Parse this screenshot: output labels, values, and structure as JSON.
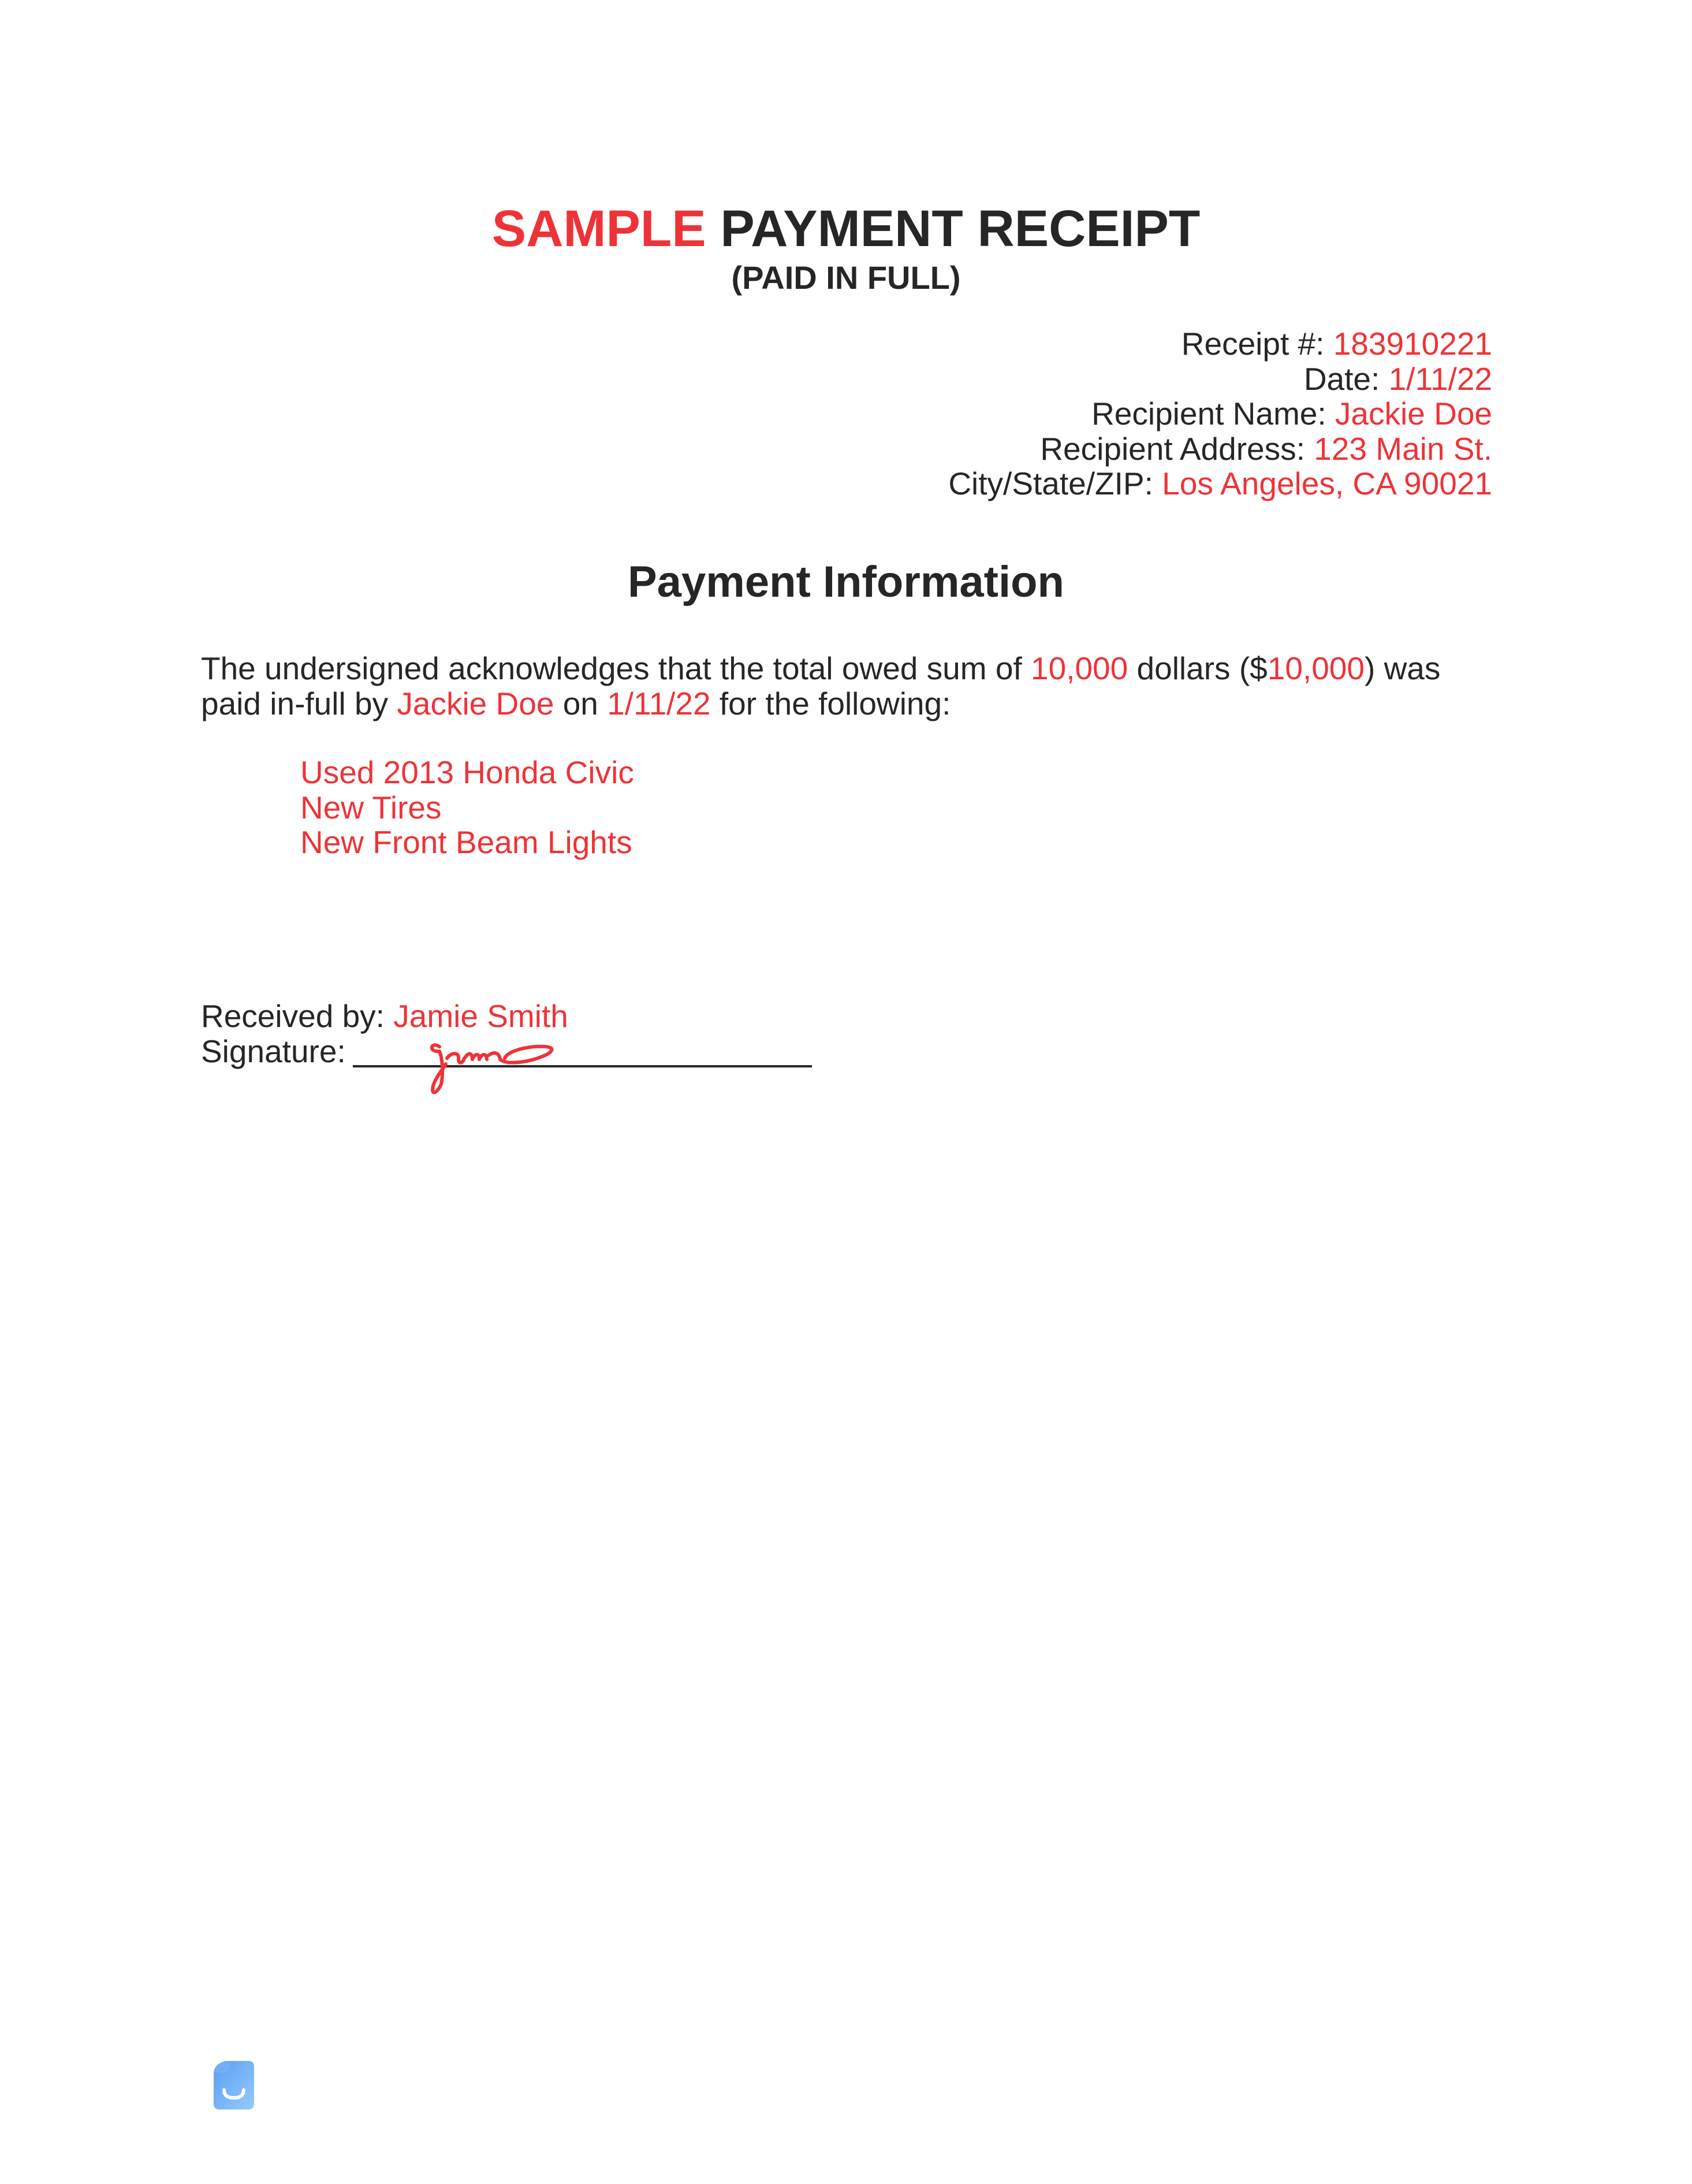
{
  "document": {
    "title_highlight": "SAMPLE",
    "title_rest": "PAYMENT RECEIPT",
    "subtitle": "(PAID IN FULL)",
    "accent_color": "#ee3338",
    "text_color": "#262626"
  },
  "receipt_info": [
    {
      "label": "Receipt #:",
      "value": "183910221"
    },
    {
      "label": "Date:",
      "value": "1/11/22"
    },
    {
      "label": "Recipient Name:",
      "value": "Jackie Doe"
    },
    {
      "label": "Recipient Address:",
      "value": "123 Main St."
    },
    {
      "label": "City/State/ZIP:",
      "value": "Los Angeles, CA 90021"
    }
  ],
  "payment": {
    "heading": "Payment Information",
    "text_1": "The undersigned acknowledges that the total owed sum of",
    "amount_words": "10,000",
    "text_2": "dollars ($",
    "amount_number": "10,000",
    "text_3": ") was paid in-full by",
    "payer": "Jackie Doe",
    "text_4": "on",
    "date": "1/11/22",
    "text_5": "for the following:",
    "items": [
      "Used 2013 Honda Civic",
      "New Tires",
      "New Front Beam Lights"
    ]
  },
  "signature_block": {
    "received_label": "Received by:",
    "received_name": "Jamie Smith",
    "signature_label": "Signature:",
    "signature_icon": "handwritten-signature"
  },
  "footer": {
    "logo_icon": "smiling-document-logo"
  }
}
